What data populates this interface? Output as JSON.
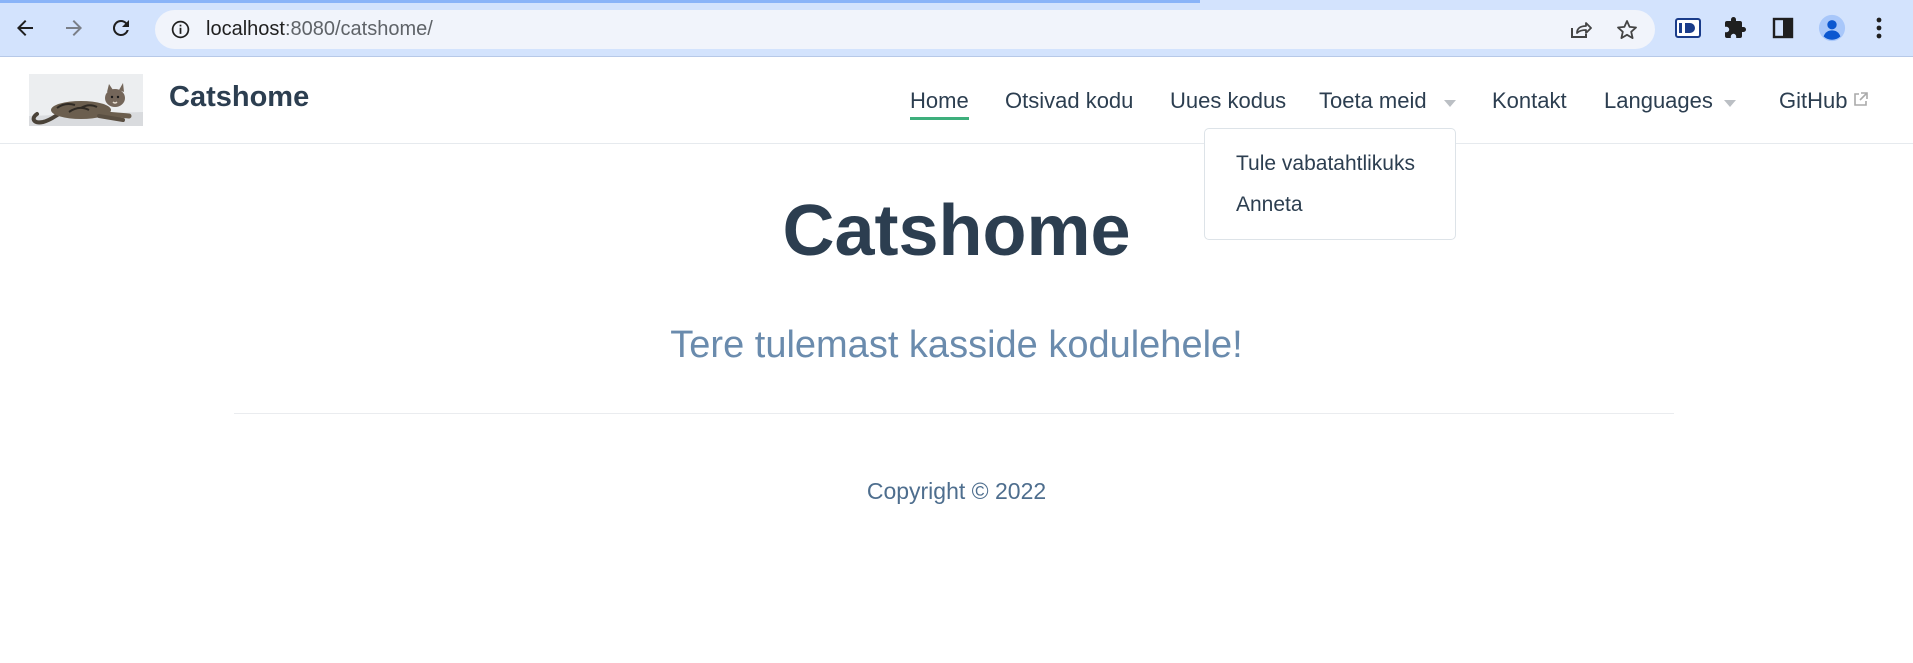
{
  "browser": {
    "url_host": "localhost",
    "url_path": ":8080/catshome/",
    "extension_badge": "iD"
  },
  "site": {
    "title": "Catshome",
    "nav": [
      {
        "label": "Home",
        "active": true
      },
      {
        "label": "Otsivad kodu"
      },
      {
        "label": "Uues kodus"
      },
      {
        "label": "Toeta meid",
        "dropdown": true
      },
      {
        "label": "Kontakt"
      },
      {
        "label": "Languages",
        "dropdown": true
      },
      {
        "label": "GitHub",
        "external": true
      }
    ],
    "dropdown_open": {
      "parent": "Toeta meid",
      "items": [
        "Tule vabatahtlikuks",
        "Anneta"
      ]
    }
  },
  "hero": {
    "title": "Catshome",
    "tagline": "Tere tulemast kasside kodulehele!"
  },
  "footer": {
    "copyright": "Copyright © 2022"
  },
  "colors": {
    "browser_bar": "#d3e3fd",
    "text": "#2c3e50",
    "accent": "#3eaf7c",
    "tagline": "#6a8bad"
  }
}
